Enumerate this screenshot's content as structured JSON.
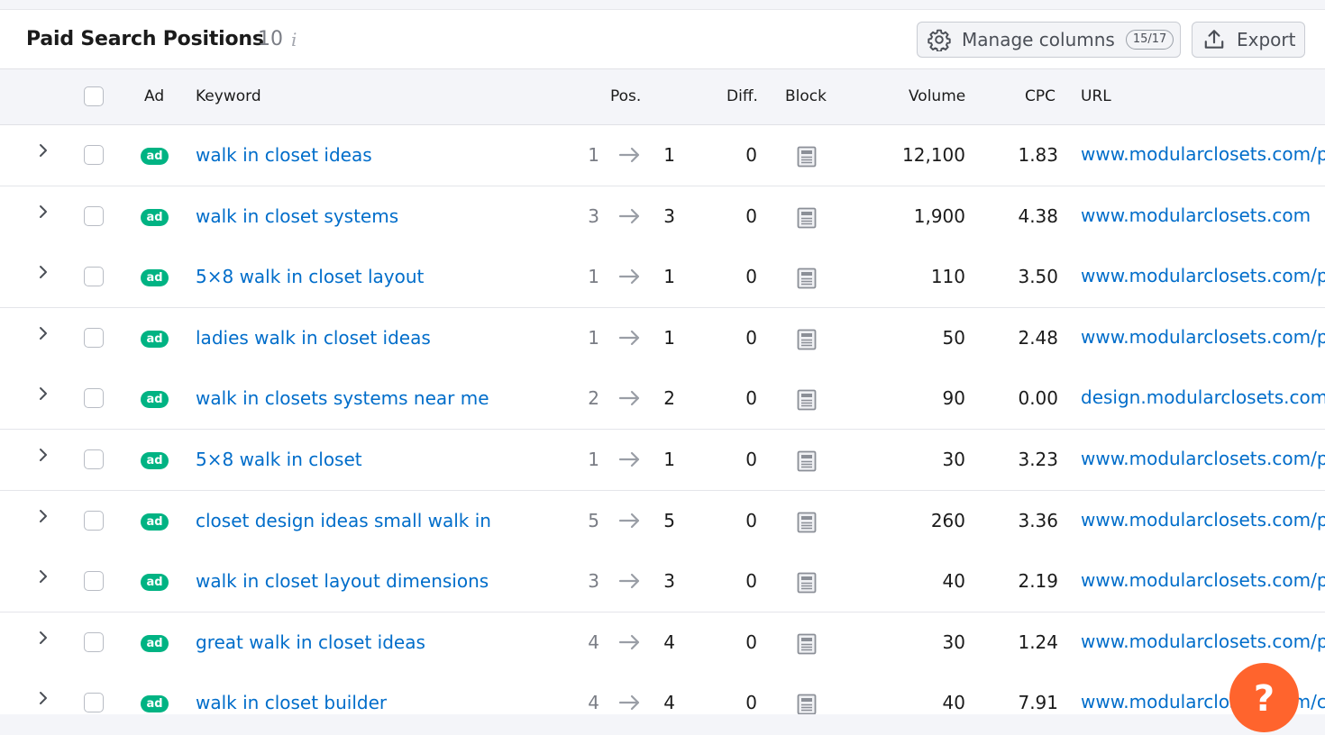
{
  "header": {
    "title": "Paid Search Positions",
    "count": "10",
    "info_icon": "info-icon",
    "manage_columns_label": "Manage columns",
    "manage_columns_badge": "15/17",
    "export_label": "Export"
  },
  "columns": {
    "ad": "Ad",
    "keyword": "Keyword",
    "pos": "Pos.",
    "diff": "Diff.",
    "block": "Block",
    "volume": "Volume",
    "cpc": "CPC",
    "url": "URL"
  },
  "rows": [
    {
      "ad": "ad",
      "keyword": "walk in closet ideas",
      "pos_prev": "1",
      "pos_cur": "1",
      "diff": "0",
      "volume": "12,100",
      "cpc": "1.83",
      "url": "www.modularclosets.com/p"
    },
    {
      "ad": "ad",
      "keyword": "walk in closet systems",
      "pos_prev": "3",
      "pos_cur": "3",
      "diff": "0",
      "volume": "1,900",
      "cpc": "4.38",
      "url": "www.modularclosets.com"
    },
    {
      "ad": "ad",
      "keyword": "5×8 walk in closet layout",
      "pos_prev": "1",
      "pos_cur": "1",
      "diff": "0",
      "volume": "110",
      "cpc": "3.50",
      "url": "www.modularclosets.com/p"
    },
    {
      "ad": "ad",
      "keyword": "ladies walk in closet ideas",
      "pos_prev": "1",
      "pos_cur": "1",
      "diff": "0",
      "volume": "50",
      "cpc": "2.48",
      "url": "www.modularclosets.com/p"
    },
    {
      "ad": "ad",
      "keyword": "walk in closets systems near me",
      "pos_prev": "2",
      "pos_cur": "2",
      "diff": "0",
      "volume": "90",
      "cpc": "0.00",
      "url": "design.modularclosets.com"
    },
    {
      "ad": "ad",
      "keyword": "5×8 walk in closet",
      "pos_prev": "1",
      "pos_cur": "1",
      "diff": "0",
      "volume": "30",
      "cpc": "3.23",
      "url": "www.modularclosets.com/p"
    },
    {
      "ad": "ad",
      "keyword": "closet design ideas small walk in",
      "pos_prev": "5",
      "pos_cur": "5",
      "diff": "0",
      "volume": "260",
      "cpc": "3.36",
      "url": "www.modularclosets.com/p"
    },
    {
      "ad": "ad",
      "keyword": "walk in closet layout dimensions",
      "pos_prev": "3",
      "pos_cur": "3",
      "diff": "0",
      "volume": "40",
      "cpc": "2.19",
      "url": "www.modularclosets.com/p"
    },
    {
      "ad": "ad",
      "keyword": "great walk in closet ideas",
      "pos_prev": "4",
      "pos_cur": "4",
      "diff": "0",
      "volume": "30",
      "cpc": "1.24",
      "url": "www.modularclosets.com/p"
    },
    {
      "ad": "ad",
      "keyword": "walk in closet builder",
      "pos_prev": "4",
      "pos_cur": "4",
      "diff": "0",
      "volume": "40",
      "cpc": "7.91",
      "url": "www.modularclosets.com/c"
    }
  ],
  "help": {
    "label": "?",
    "icon": "question-icon"
  },
  "colors": {
    "link": "#006dca",
    "ad_badge": "#00b383",
    "help_button": "#ff642d",
    "header_bg": "#f4f5f9"
  }
}
